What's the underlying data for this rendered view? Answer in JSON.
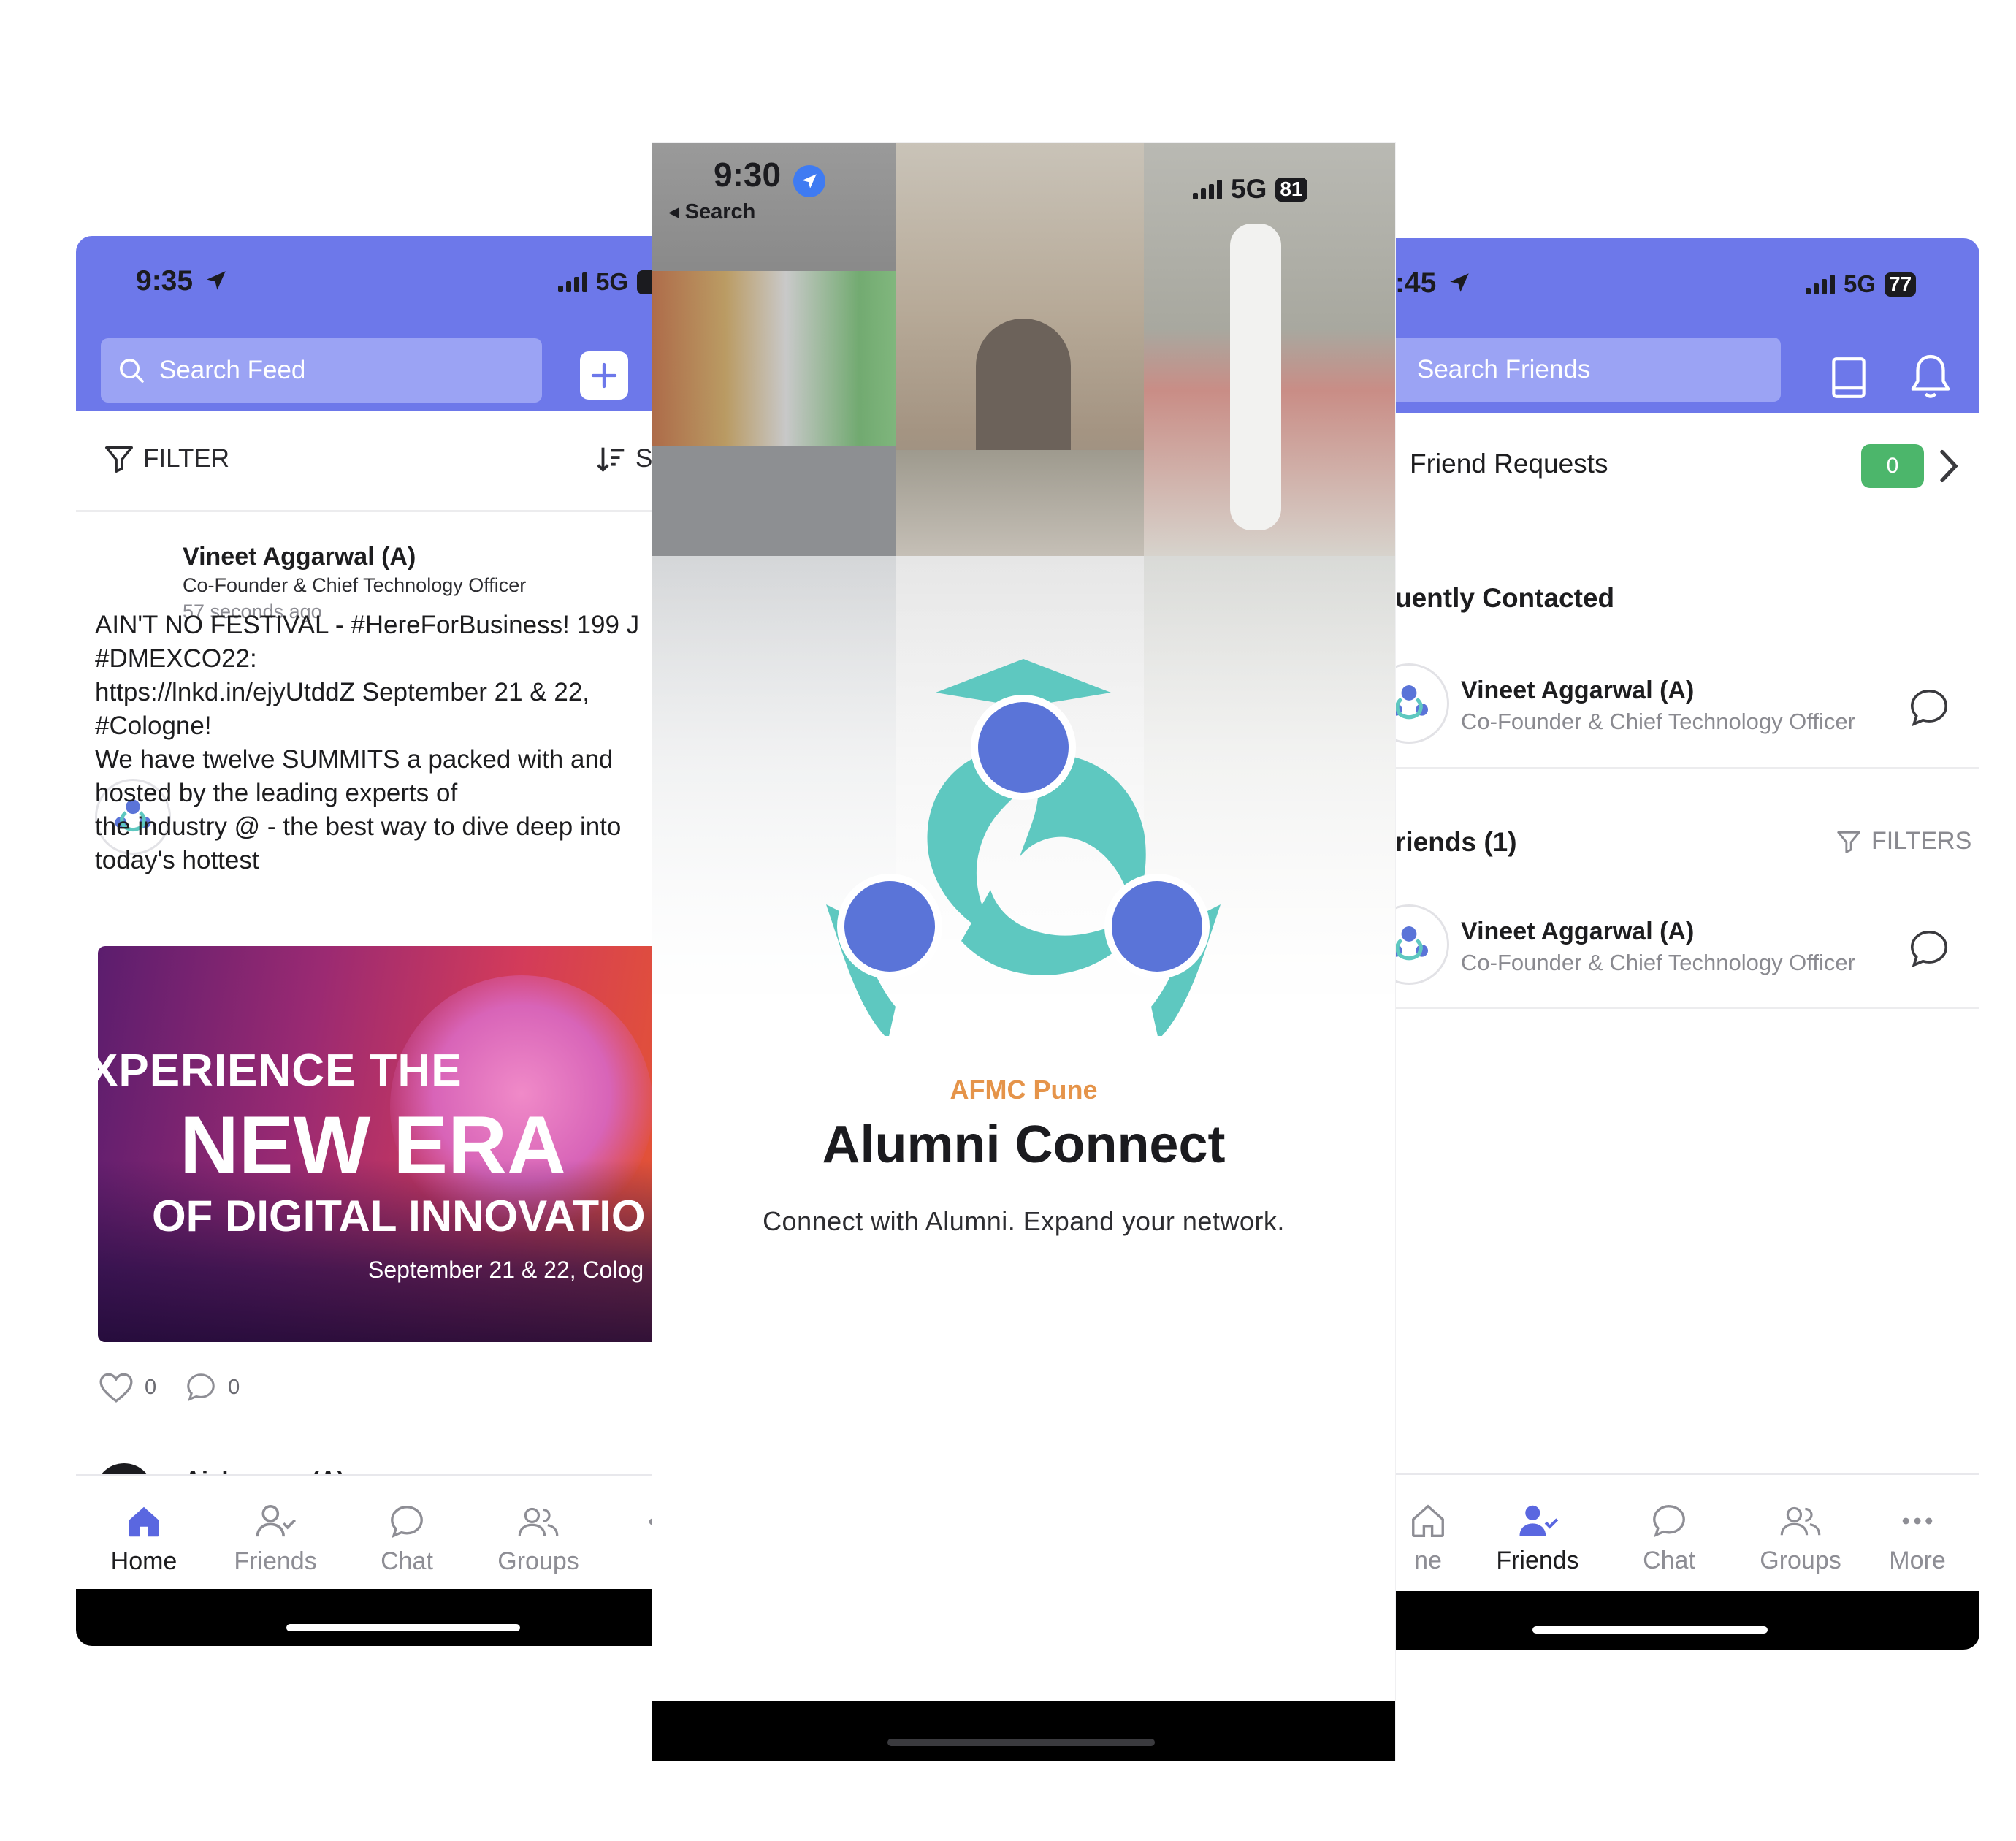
{
  "home_screen": {
    "status": {
      "time": "9:35",
      "network": "5G"
    },
    "search": {
      "placeholder": "Search Feed"
    },
    "filter_label": "FILTER",
    "sort_label": "S",
    "post": {
      "author": "Vineet Aggarwal (A)",
      "role": "Co-Founder & Chief Technology Officer",
      "time": "57 seconds ago",
      "body_lines": [
        "AIN'T NO FESTIVAL - #HereForBusiness! 199 J",
        "#DMEXCO22:",
        "https://lnkd.in/ejyUtddZ September 21 & 22,",
        "#Cologne!",
        "We have twelve SUMMITS a packed with and",
        "hosted by the leading experts of",
        "the industry @ - the best way to dive deep into",
        "today's hottest"
      ],
      "image": {
        "line1": "XPERIENCE THE",
        "line2": "NEW ERA",
        "line3": "OF DIGITAL INNOVATIO",
        "line4": "September 21 & 22, Colog"
      },
      "likes": "0",
      "comments": "0"
    },
    "next_post_author": "Aishwarya (A)",
    "tabs": [
      {
        "label": "Home",
        "icon": "home-icon",
        "active": true
      },
      {
        "label": "Friends",
        "icon": "user-check-icon",
        "active": false
      },
      {
        "label": "Chat",
        "icon": "chat-bubble-icon",
        "active": false
      },
      {
        "label": "Groups",
        "icon": "users-icon",
        "active": false
      },
      {
        "label": "M",
        "icon": "more-icon",
        "active": false
      }
    ]
  },
  "splash_screen": {
    "status": {
      "time": "9:30",
      "back_label": "◂ Search",
      "network": "5G",
      "battery": "81"
    },
    "kicker": "AFMC Pune",
    "title": "Alumni Connect",
    "tagline": "Connect with Alumni. Expand your network."
  },
  "friends_screen": {
    "status": {
      "time": ":45",
      "network": "5G",
      "battery": "77"
    },
    "search": {
      "placeholder": "Search Friends"
    },
    "friend_requests": {
      "label": "Friend Requests",
      "count": "0"
    },
    "frequently_contacted_title": "uently Contacted",
    "frequent": [
      {
        "name": "Vineet Aggarwal (A)",
        "role": "Co-Founder & Chief Technology Officer"
      }
    ],
    "friends_title": "riends (1)",
    "filters_label": "FILTERS",
    "friends": [
      {
        "name": "Vineet Aggarwal (A)",
        "role": "Co-Founder & Chief Technology Officer"
      }
    ],
    "tabs": [
      {
        "label": "ne",
        "icon": "home-icon",
        "active": false
      },
      {
        "label": "Friends",
        "icon": "user-check-icon",
        "active": true
      },
      {
        "label": "Chat",
        "icon": "chat-bubble-icon",
        "active": false
      },
      {
        "label": "Groups",
        "icon": "users-icon",
        "active": false
      },
      {
        "label": "More",
        "icon": "more-icon",
        "active": false
      }
    ]
  },
  "colors": {
    "header": "#6d78ea",
    "search_pill": "#9ba3f4",
    "accent_orange": "#e5944a",
    "logo_teal": "#5ec8c0",
    "logo_blue": "#5a74d8",
    "badge_green": "#4cb66b"
  }
}
